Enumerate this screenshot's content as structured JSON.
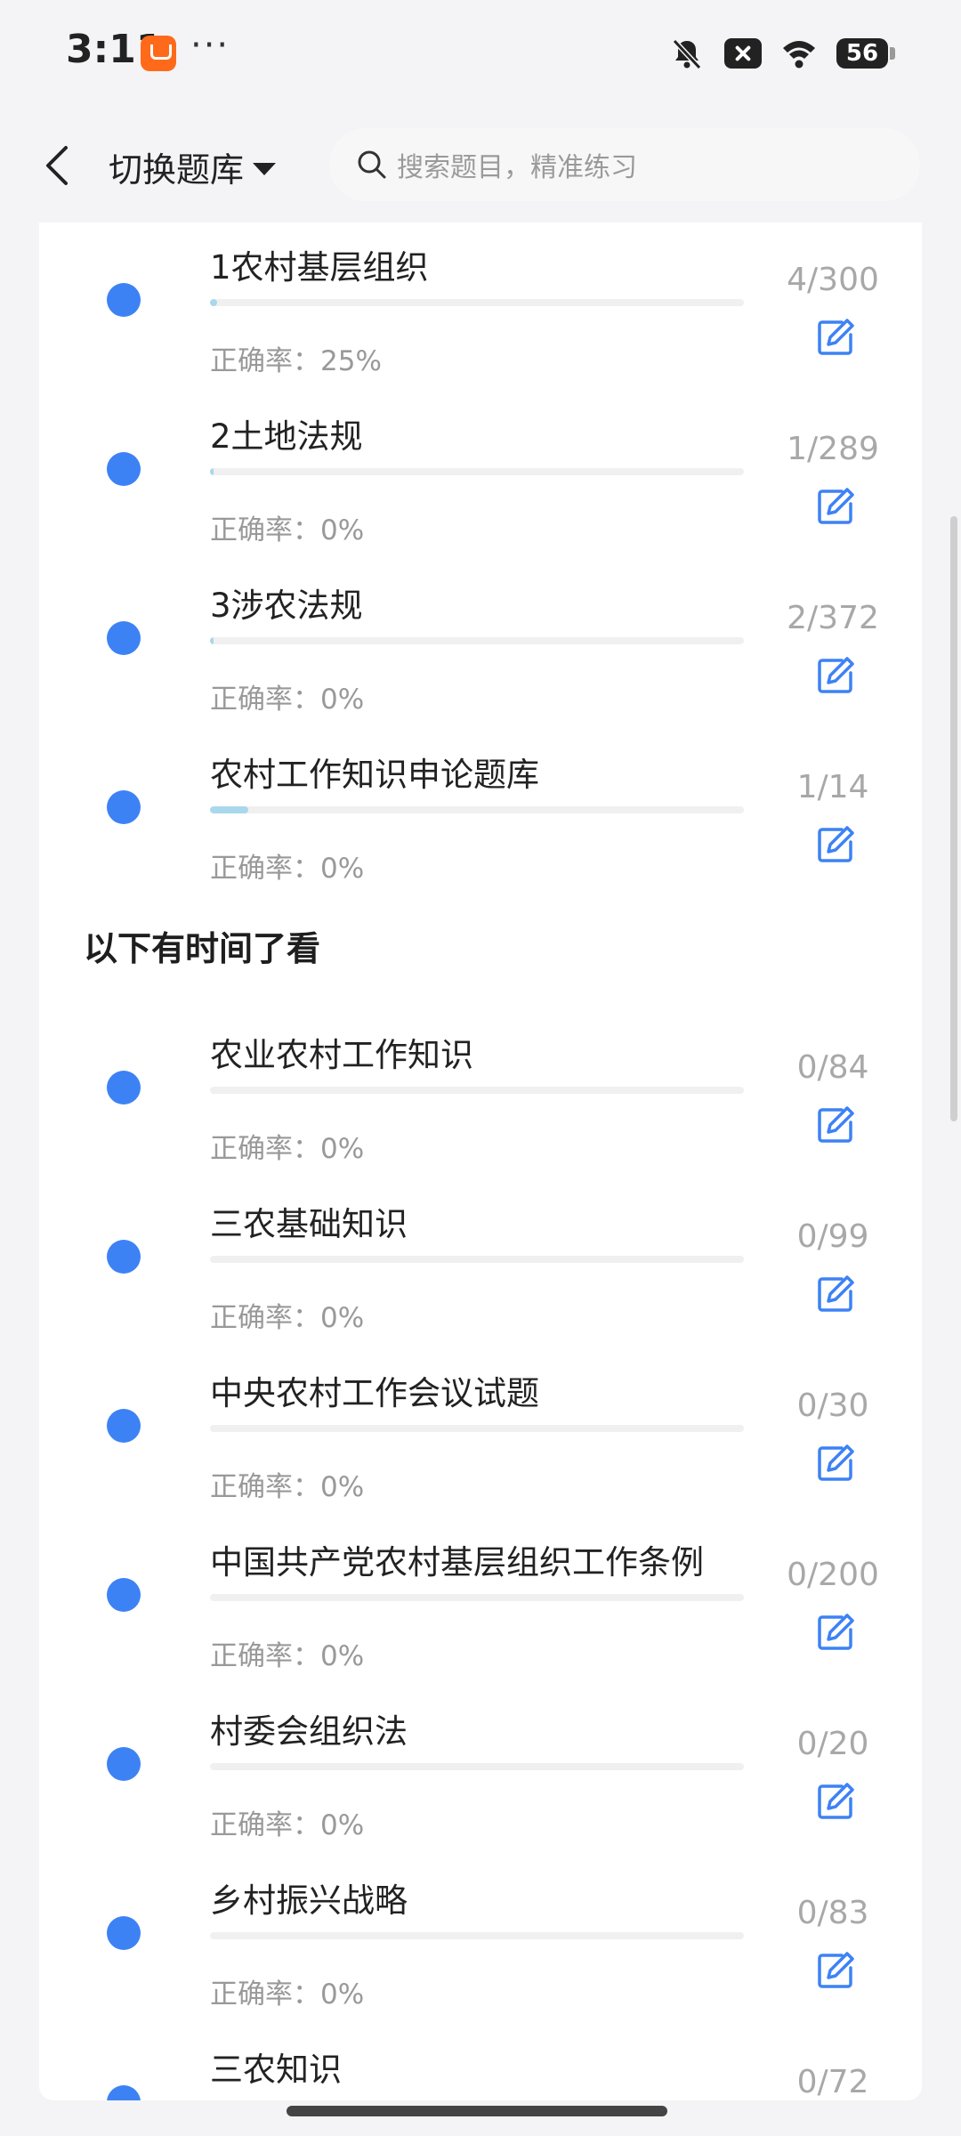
{
  "status_bar": {
    "time": "3:11",
    "dots": "···",
    "battery": "56"
  },
  "header": {
    "switch_label": "切换题库",
    "search_placeholder": "搜索题目，精准练习"
  },
  "groups": [
    {
      "heading": "",
      "items": [
        {
          "title": "1农村基层组织",
          "accuracy": "正确率：25%",
          "count": "4/300",
          "progress": 0.013
        },
        {
          "title": "2土地法规",
          "accuracy": "正确率：0%",
          "count": "1/289",
          "progress": 0.003
        },
        {
          "title": "3涉农法规",
          "accuracy": "正确率：0%",
          "count": "2/372",
          "progress": 0.005
        },
        {
          "title": "农村工作知识申论题库",
          "accuracy": "正确率：0%",
          "count": "1/14",
          "progress": 0.071
        }
      ]
    },
    {
      "heading": "以下有时间了看",
      "items": [
        {
          "title": "农业农村工作知识",
          "accuracy": "正确率：0%",
          "count": "0/84",
          "progress": 0
        },
        {
          "title": "三农基础知识",
          "accuracy": "正确率：0%",
          "count": "0/99",
          "progress": 0
        },
        {
          "title": "中央农村工作会议试题",
          "accuracy": "正确率：0%",
          "count": "0/30",
          "progress": 0
        },
        {
          "title": "中国共产党农村基层组织工作条例",
          "accuracy": "正确率：0%",
          "count": "0/200",
          "progress": 0
        },
        {
          "title": "村委会组织法",
          "accuracy": "正确率：0%",
          "count": "0/20",
          "progress": 0
        },
        {
          "title": "乡村振兴战略",
          "accuracy": "正确率：0%",
          "count": "0/83",
          "progress": 0
        },
        {
          "title": "三农知识",
          "accuracy": "",
          "count": "0/72",
          "progress": 0
        }
      ]
    }
  ],
  "colors": {
    "accent": "#3d82f5",
    "progress": "#a9d8ec",
    "muted": "#999999"
  }
}
